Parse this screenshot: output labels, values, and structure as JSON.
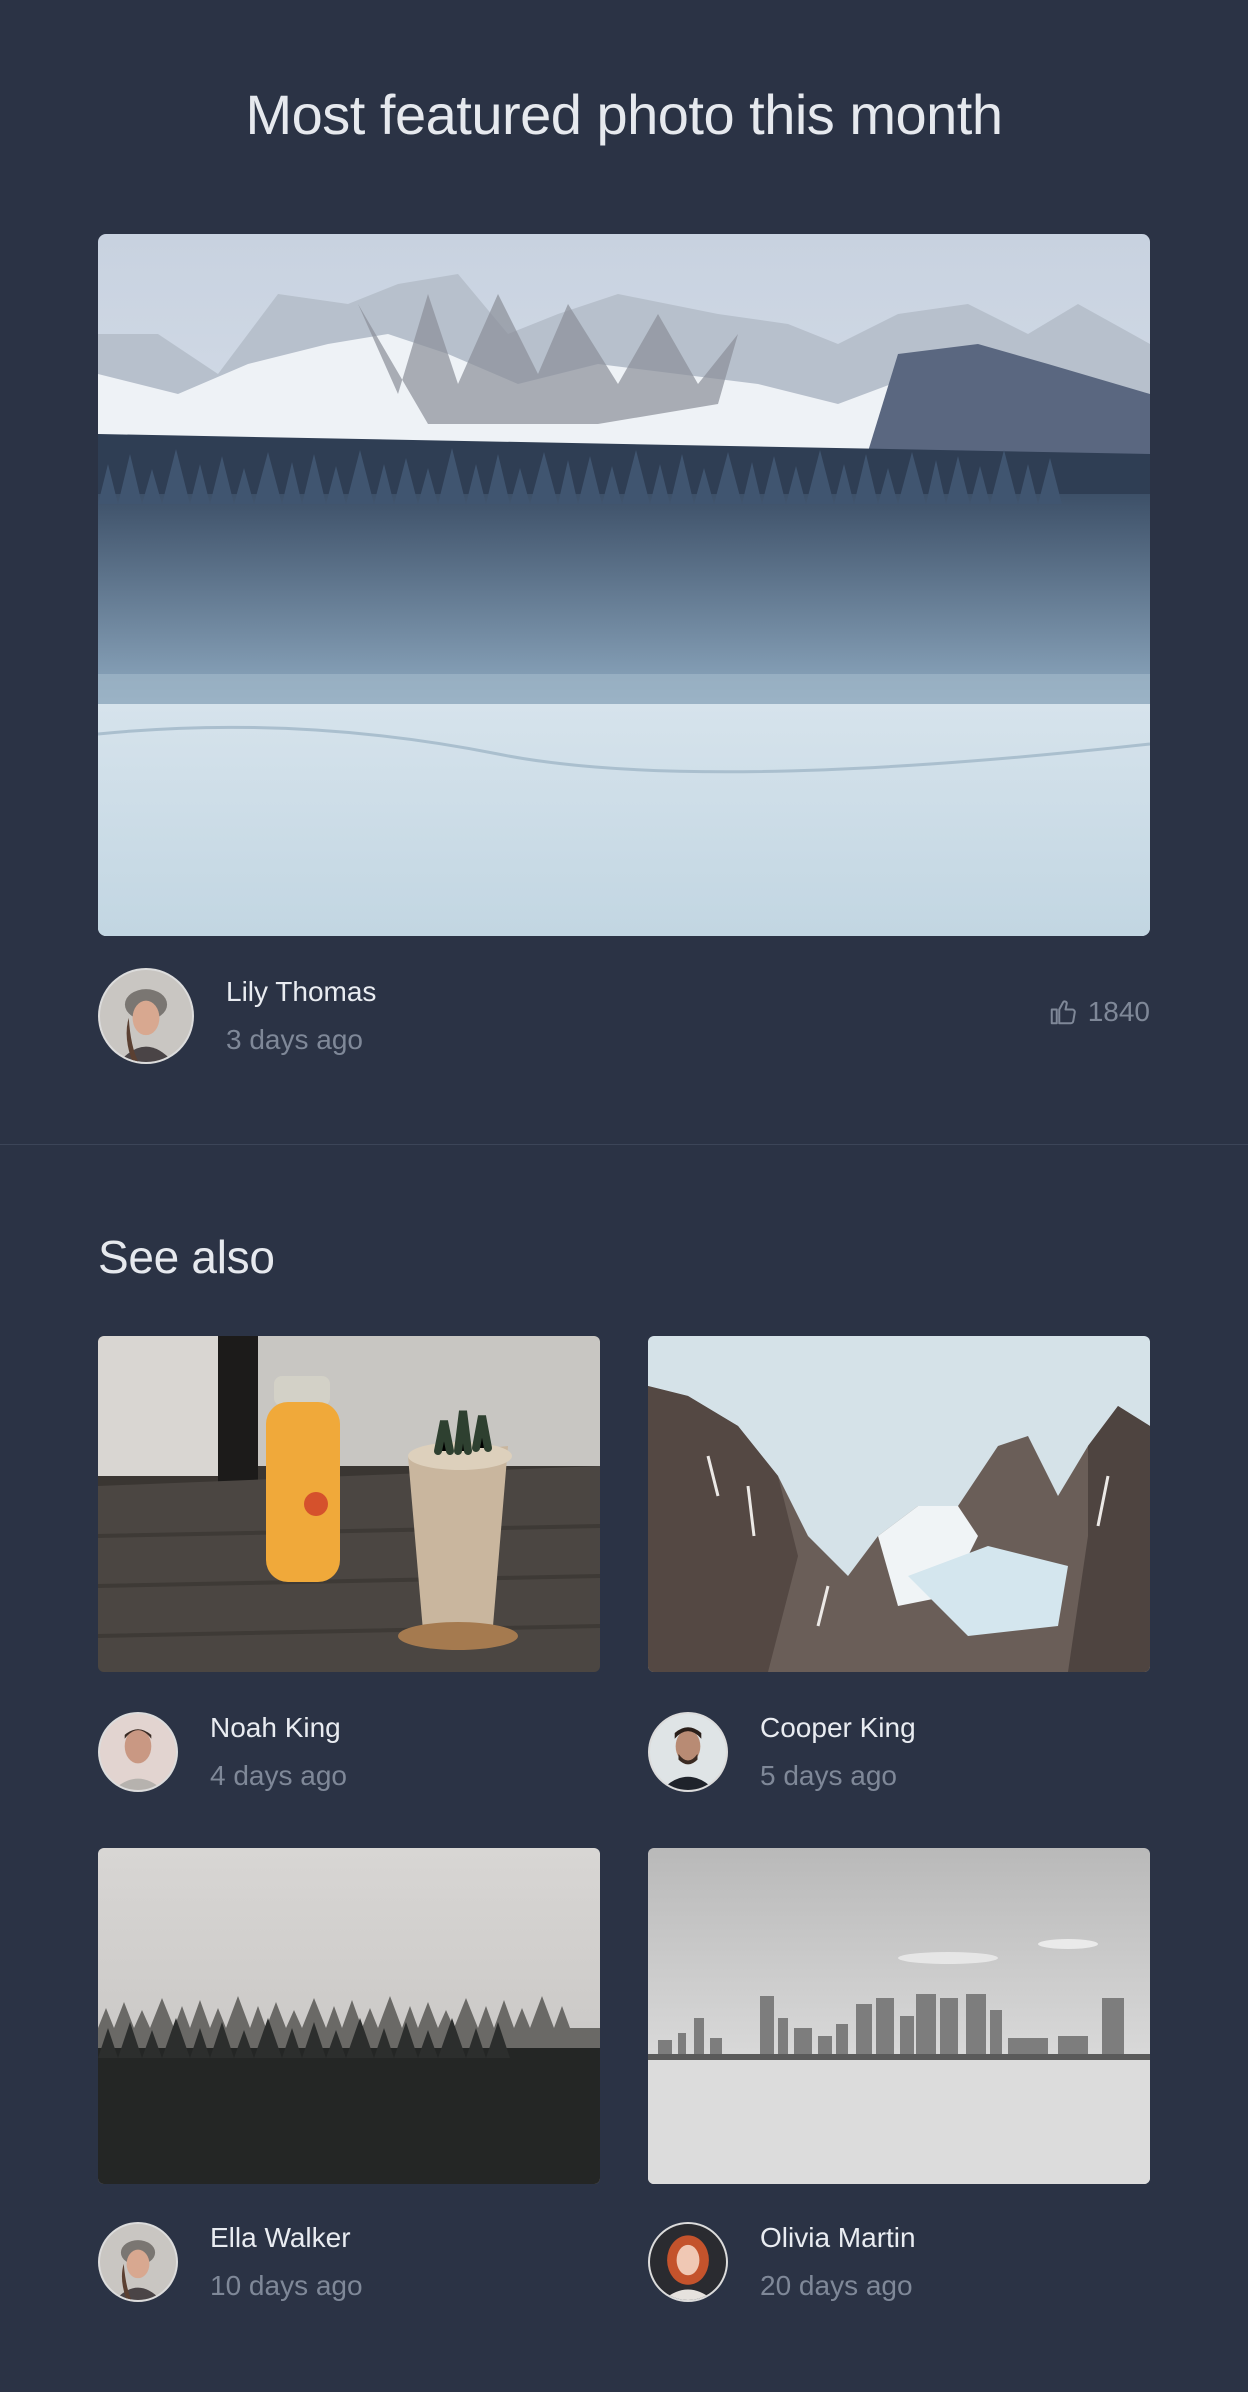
{
  "featured": {
    "title": "Most featured photo this month",
    "image_icon": "snowy-mountain-forest-photo",
    "author": "Lily Thomas",
    "time": "3 days ago",
    "likes": "1840"
  },
  "see_also": {
    "title": "See also",
    "items": [
      {
        "image_icon": "juice-bottle-cactus-photo",
        "author": "Noah King",
        "time": "4 days ago"
      },
      {
        "image_icon": "rocky-mountains-photo",
        "author": "Cooper King",
        "time": "5 days ago"
      },
      {
        "image_icon": "foggy-forest-photo",
        "author": "Ella Walker",
        "time": "10 days ago"
      },
      {
        "image_icon": "city-skyline-photo",
        "author": "Olivia Martin",
        "time": "20 days ago"
      }
    ]
  },
  "colors": {
    "background": "#2b3345",
    "primary_text": "#e9ecf1",
    "muted_text": "#7f8898"
  }
}
